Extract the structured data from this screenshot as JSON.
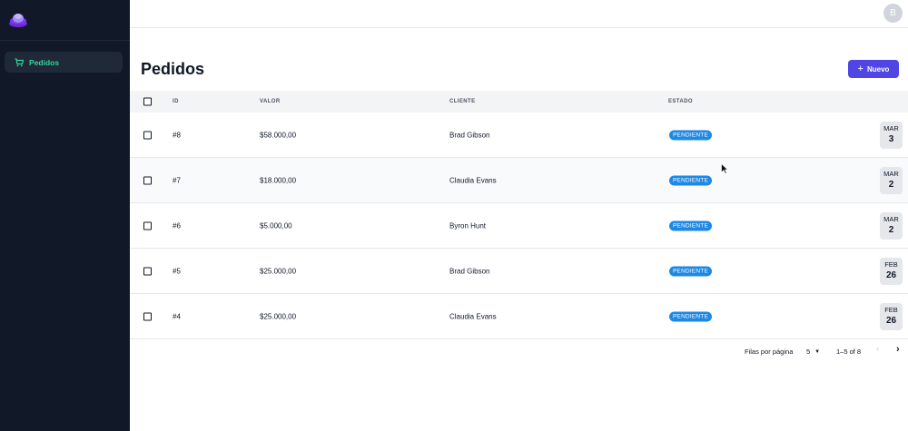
{
  "sidebar": {
    "items": [
      {
        "label": "Pedidos",
        "icon": "cart-icon",
        "active": true
      }
    ]
  },
  "header": {
    "avatar_letter": "B"
  },
  "page": {
    "title": "Pedidos",
    "new_button": "Nuevo"
  },
  "table": {
    "columns": [
      "ID",
      "VALOR",
      "CLIENTE",
      "ESTADO"
    ],
    "rows": [
      {
        "id": "#8",
        "valor": "$58.000,00",
        "cliente": "Brad Gibson",
        "estado": "PENDIENTE",
        "month": "MAR",
        "day": "3"
      },
      {
        "id": "#7",
        "valor": "$18.000,00",
        "cliente": "Claudia Evans",
        "estado": "PENDIENTE",
        "month": "MAR",
        "day": "2"
      },
      {
        "id": "#6",
        "valor": "$5.000,00",
        "cliente": "Byron Hunt",
        "estado": "PENDIENTE",
        "month": "MAR",
        "day": "2"
      },
      {
        "id": "#5",
        "valor": "$25.000,00",
        "cliente": "Brad Gibson",
        "estado": "PENDIENTE",
        "month": "FEB",
        "day": "26"
      },
      {
        "id": "#4",
        "valor": "$25.000,00",
        "cliente": "Claudia Evans",
        "estado": "PENDIENTE",
        "month": "FEB",
        "day": "26"
      }
    ]
  },
  "pagination": {
    "rows_per_page_label": "Filas por página",
    "rows_per_page": "5",
    "range": "1–5 of 8"
  },
  "colors": {
    "sidebar_bg": "#111827",
    "accent": "#4f46e5",
    "active_nav_text": "#34d399",
    "badge": "#1e88e5"
  }
}
